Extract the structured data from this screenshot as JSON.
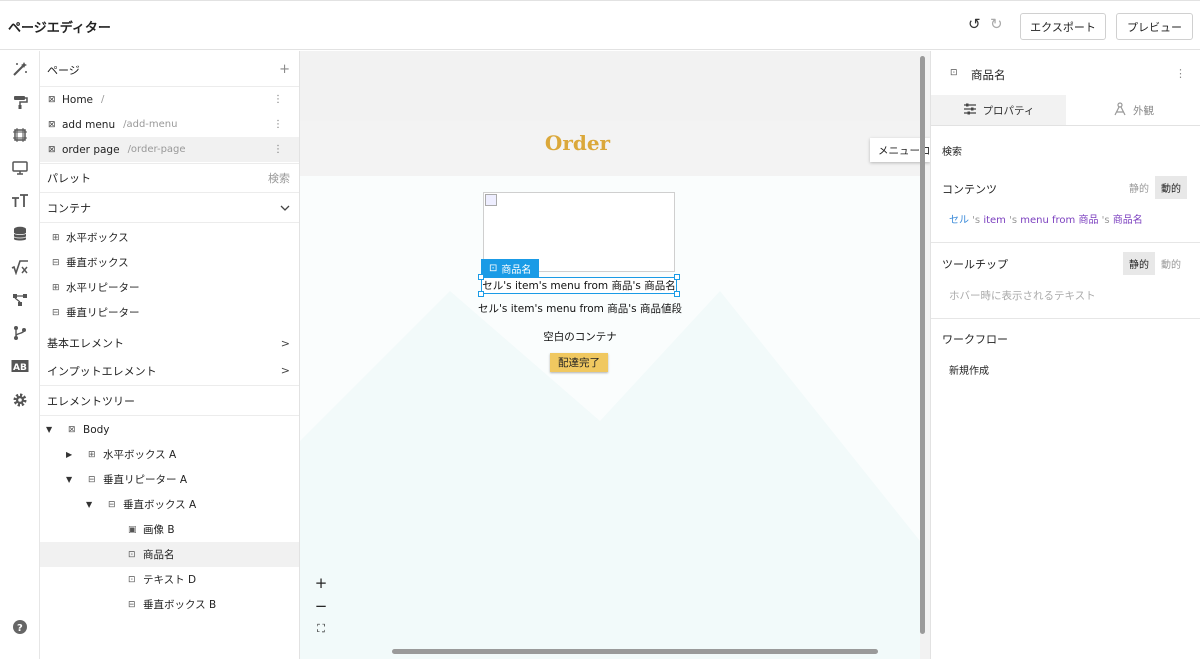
{
  "header": {
    "title": "ページエディター",
    "export_label": "エクスポート",
    "preview_label": "プレビュー",
    "undo_icon": "↺",
    "redo_icon": "↻"
  },
  "rail": {
    "icons": [
      "magic-wand-icon",
      "paint-roller-icon",
      "frame-icon",
      "monitor-icon",
      "typography-icon",
      "database-icon",
      "formula-icon",
      "workflow-icon",
      "branch-icon",
      "ab-icon",
      "gear-icon",
      "help-icon"
    ]
  },
  "pages": {
    "title": "ページ",
    "add_icon": "+",
    "items": [
      {
        "name": "Home",
        "path": "/"
      },
      {
        "name": "add menu",
        "path": "/add-menu"
      },
      {
        "name": "order page",
        "path": "/order-page"
      }
    ]
  },
  "palette": {
    "title": "パレット",
    "search_label": "検索",
    "container_title": "コンテナ",
    "items": [
      "水平ボックス",
      "垂直ボックス",
      "水平リピーター",
      "垂直リピーター"
    ],
    "basic_elements": "基本エレメント",
    "input_elements": "インプットエレメント"
  },
  "tree": {
    "title": "エレメントツリー",
    "items": [
      {
        "label": "Body",
        "depth": 0,
        "arrow": "▼"
      },
      {
        "label": "水平ボックス A",
        "depth": 1,
        "arrow": "▶"
      },
      {
        "label": "垂直リピーター A",
        "depth": 1,
        "arrow": "▼"
      },
      {
        "label": "垂直ボックス A",
        "depth": 2,
        "arrow": "▼"
      },
      {
        "label": "画像 B",
        "depth": 3,
        "arrow": ""
      },
      {
        "label": "商品名",
        "depth": 3,
        "arrow": ""
      },
      {
        "label": "テキスト D",
        "depth": 3,
        "arrow": ""
      },
      {
        "label": "垂直ボックス B",
        "depth": 3,
        "arrow": ""
      }
    ]
  },
  "canvas": {
    "page_title": "Order",
    "menu_tab": "メニューコ",
    "selected_label": "商品名",
    "selected_text": "セル's item's menu from 商品's 商品名",
    "price_text": "セル's item's menu from 商品's 商品値段",
    "empty_container": "空白のコンテナ",
    "done_button": "配達完了",
    "zoom_in": "+",
    "zoom_out": "−",
    "fit": "⛶"
  },
  "inspector": {
    "title": "商品名",
    "tab_properties": "プロパティ",
    "tab_appearance": "外観",
    "search_label": "検索",
    "content_label": "コンテンツ",
    "static_label": "静的",
    "dynamic_label": "動的",
    "content_parts": [
      "セル",
      " 's ",
      "item",
      " 's ",
      "menu from 商品",
      " 's ",
      "商品名"
    ],
    "tooltip_label": "ツールチップ",
    "tooltip_placeholder": "ホバー時に表示されるテキスト",
    "workflow_label": "ワークフロー",
    "new_workflow": "新規作成"
  },
  "colors": {
    "accent_blue": "#1a9be6",
    "order_gold": "#dba83a",
    "button_yellow": "#f0c860",
    "dynamic_purple": "#7b3fbf"
  }
}
